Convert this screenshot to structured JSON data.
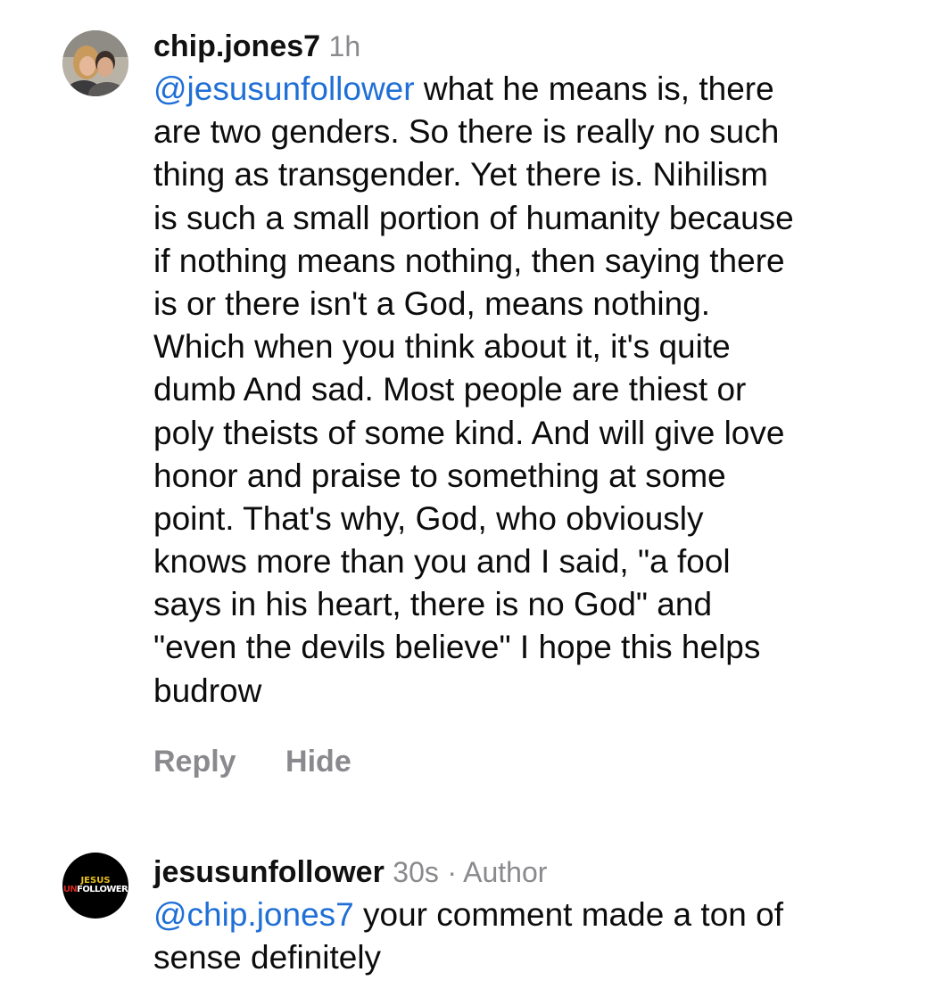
{
  "comments": [
    {
      "username": "chip.jones7",
      "time": "1h",
      "author_badge": "",
      "mention": "@jesusunfollower",
      "lines": [
        " what he means is, there",
        "are two genders. So there is really no such",
        "thing as transgender. Yet there is. Nihilism",
        "is such a small portion of humanity because",
        "if nothing means nothing, then saying there",
        "is or there isn't a God, means nothing.",
        "Which when you think about it, it's quite",
        "dumb  And sad. Most people are thiest or",
        "poly theists of some kind. And will give love",
        "honor and praise to something at some",
        "point. That's why, God, who obviously",
        "knows more than you and I said, \"a fool",
        "says in his heart, there is no God\" and",
        "\"even the devils believe\" I hope this helps",
        "budrow"
      ],
      "actions": {
        "reply": "Reply",
        "hide": "Hide"
      },
      "avatar_icon": "user-photo-avatar"
    },
    {
      "username": "jesusunfollower",
      "time": "30s",
      "author_badge": "· Author",
      "mention": "@chip.jones7",
      "lines": [
        " your comment made a ton of",
        "sense definitely"
      ],
      "avatar_icon": "jesus-unfollower-logo",
      "logo": {
        "line1": "JESUS",
        "line2_accent": "UN",
        "line2_rest": "FOLLOWER"
      }
    }
  ],
  "colors": {
    "mention": "#1f6fd6",
    "meta_gray": "#8a8a8e",
    "logo_yellow": "#e8c21a",
    "logo_red": "#d6291e"
  }
}
